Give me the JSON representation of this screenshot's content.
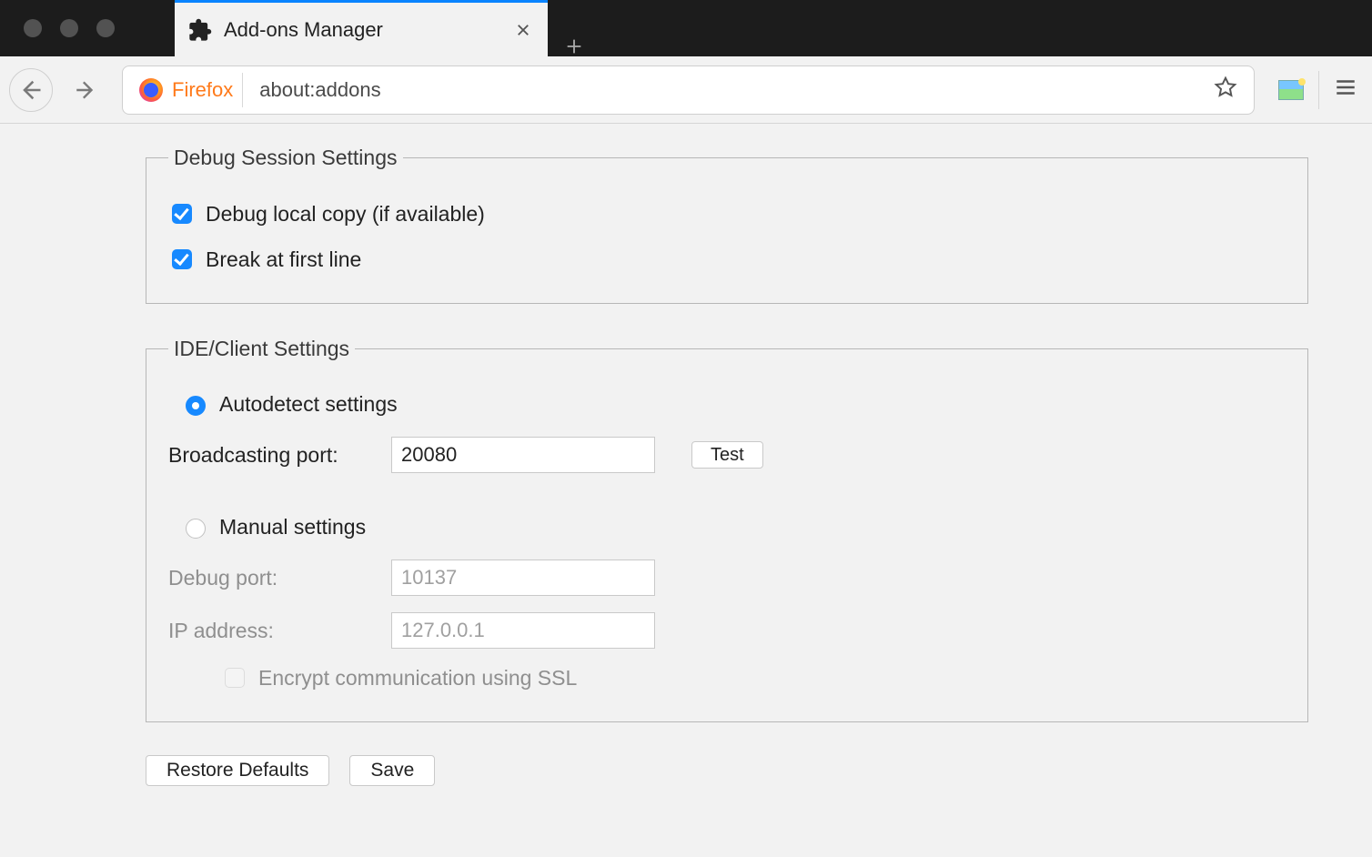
{
  "tab": {
    "title": "Add-ons Manager"
  },
  "urlbar": {
    "identity": "Firefox",
    "url": "about:addons"
  },
  "settings": {
    "debug_session": {
      "legend": "Debug Session Settings",
      "debug_local_label": "Debug local copy (if available)",
      "debug_local_checked": true,
      "break_first_label": "Break at first line",
      "break_first_checked": true
    },
    "ide": {
      "legend": "IDE/Client Settings",
      "mode": "auto",
      "auto_label": "Autodetect settings",
      "broadcasting_port_label": "Broadcasting port:",
      "broadcasting_port_value": "20080",
      "test_label": "Test",
      "manual_label": "Manual settings",
      "debug_port_label": "Debug port:",
      "debug_port_value": "10137",
      "ip_label": "IP address:",
      "ip_value": "127.0.0.1",
      "ssl_label": "Encrypt communication using SSL",
      "ssl_checked": false
    },
    "footer": {
      "restore_label": "Restore Defaults",
      "save_label": "Save"
    }
  }
}
